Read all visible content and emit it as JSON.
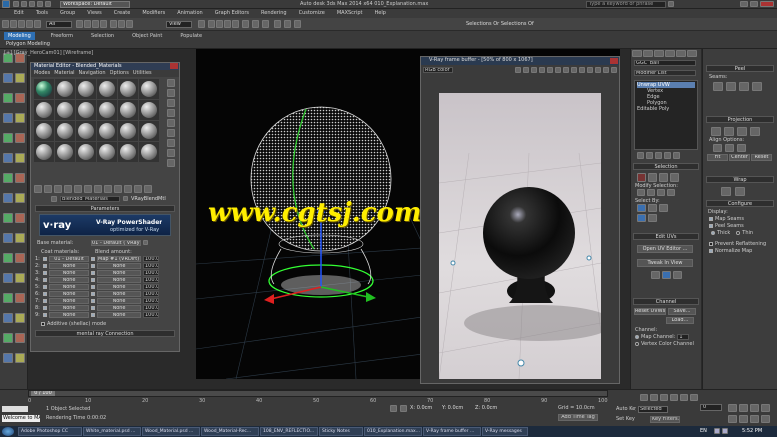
{
  "window": {
    "title": "Workspace: Default",
    "file_title": "Auto desk 3ds Max 2014 x64   010_Explanation.max",
    "search_placeholder": "Type a keyword or phrase"
  },
  "menu": [
    "Edit",
    "Tools",
    "Group",
    "Views",
    "Create",
    "Modifiers",
    "Animation",
    "Graph Editors",
    "Rendering",
    "Customize",
    "MAXScript",
    "Help"
  ],
  "toolbar": {
    "selection_filter": "All",
    "view_dropdown": "View",
    "selection_set": "Selections Or Selections Of"
  },
  "ribbon": {
    "tabs": [
      "Modeling",
      "Freeform",
      "Selection",
      "Object Paint",
      "Populate"
    ],
    "sub_label": "Polygon Modeling"
  },
  "viewport": {
    "label": "[+] [Gray_HeroCam01] [Wireframe]"
  },
  "material_editor": {
    "title": "Material Editor - Blended_Materials",
    "menu": [
      "Modes",
      "Material",
      "Navigation",
      "Options",
      "Utilities"
    ],
    "mat_name": "Blended_Materials",
    "mat_type": "VRayBlendMtl",
    "params_header": "Parameters",
    "banner_logo": "v·ray",
    "banner_title": "V-Ray PowerShader",
    "banner_sub": "optimized for V-Ray",
    "base_label": "Base material:",
    "base_value": "01 - Default ( VRayMtl )",
    "coat_label": "Coat materials:",
    "blend_label": "Blend amount:",
    "rows": [
      {
        "n": "1:",
        "coat": "01 - Default",
        "blend": "Map #1 (VRDirt) ( )",
        "amt": "100.0"
      },
      {
        "n": "2:",
        "coat": "None",
        "blend": "None",
        "amt": "100.0"
      },
      {
        "n": "3:",
        "coat": "None",
        "blend": "None",
        "amt": "100.0"
      },
      {
        "n": "4:",
        "coat": "None",
        "blend": "None",
        "amt": "100.0"
      },
      {
        "n": "5:",
        "coat": "None",
        "blend": "None",
        "amt": "100.0"
      },
      {
        "n": "6:",
        "coat": "None",
        "blend": "None",
        "amt": "100.0"
      },
      {
        "n": "7:",
        "coat": "None",
        "blend": "None",
        "amt": "100.0"
      },
      {
        "n": "8:",
        "coat": "None",
        "blend": "None",
        "amt": "100.0"
      },
      {
        "n": "9:",
        "coat": "None",
        "blend": "None",
        "amt": "100.0"
      }
    ],
    "additive": "Additive (shellac) mode",
    "mr_connection": "mental ray Connection"
  },
  "vfb": {
    "title": "V-Ray frame buffer - [50% of 800 x 1067]",
    "channel": "RGB color"
  },
  "watermark": "www.cgtsj.com",
  "command_panel": {
    "object_name": "GGC_Ball",
    "modifier_list": "Modifier List",
    "stack": [
      "Unwrap UVW",
      "Vertex",
      "Edge",
      "Polygon",
      "Editable Poly"
    ],
    "selection_header": "Selection",
    "modify_selection": "Modify Selection:",
    "select_by": "Select By:",
    "edit_uvs_header": "Edit UVs",
    "open_uv_editor": "Open UV Editor ...",
    "tweak_in_view": "Tweak In View",
    "channel_header": "Channel",
    "reset_uvws": "Reset UVWs",
    "save": "Save...",
    "load": "Load...",
    "channel_label": "Channel:",
    "map_channel": "Map Channel:",
    "map_channel_val": "1",
    "vertex_color_channel": "Vertex Color Channel"
  },
  "right_panel": {
    "peel_header": "Peel",
    "seams": "Seams:",
    "projection_header": "Projection",
    "align_options": "Align Options:",
    "proj_buttons": [
      "Fit",
      "Center",
      "Reset"
    ],
    "wrap_header": "Wrap",
    "configure_header": "Configure",
    "display": "Display:",
    "map_seams": "Map Seams",
    "peel_seams": "Peel Seams",
    "thick": "Thick",
    "thin": "Thin",
    "prevent_reflattening": "Prevent Reflattening",
    "normalize_map": "Normalize Map"
  },
  "status": {
    "frame": "0 / 100",
    "selected": "1 Object Selected",
    "render_time": "Rendering Time  0:00:02",
    "x": "0.0cm",
    "y": "0.0cm",
    "z": "0.0cm",
    "grid": "Grid = 10.0cm",
    "auto_key": "Auto Key",
    "selected_dd": "Selected",
    "set_key": "Set Key",
    "key_filters": "Key Filters...",
    "add_time_tag": "Add Time Tag",
    "welcome": "Welcome to MAX",
    "ticks": [
      "0",
      "10",
      "20",
      "30",
      "40",
      "50",
      "60",
      "70",
      "80",
      "90",
      "100"
    ],
    "frame_field": "0"
  },
  "taskbar": {
    "items": [
      "Adobe Photoshop CC",
      "White_material.psd ...",
      "Wood_Material.psd ...",
      "Wood_Material-Rec...",
      "108_ENV_REFLECTIO...",
      "Sticky Notes",
      "010_Explanation.max...",
      "V-Ray frame buffer ...",
      "V-Ray messages"
    ],
    "lang": "EN",
    "time": "5:52 PM"
  }
}
